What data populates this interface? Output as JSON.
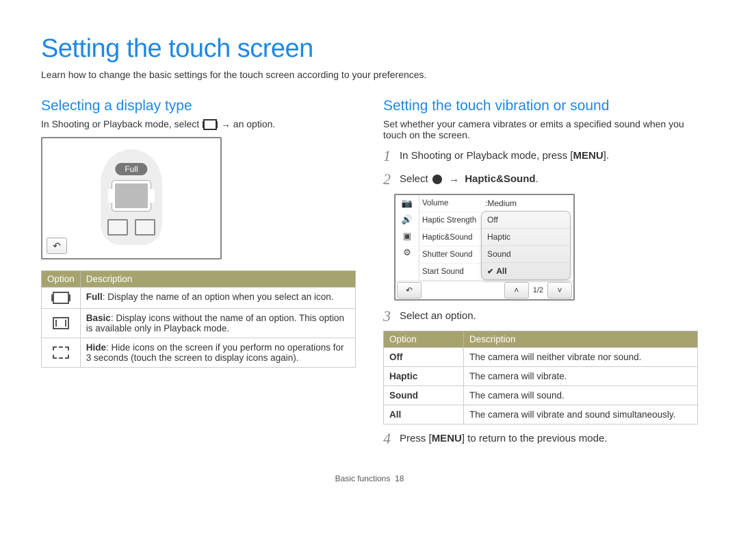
{
  "page": {
    "title": "Setting the touch screen",
    "intro": "Learn how to change the basic settings for the touch screen according to your preferences.",
    "footer_section": "Basic functions",
    "footer_page": "18"
  },
  "left": {
    "heading": "Selecting a display type",
    "lead_a": "In Shooting or Playback mode, select ",
    "lead_b": " → an option.",
    "full_badge": "Full",
    "table": {
      "h_option": "Option",
      "h_desc": "Description",
      "rows": [
        {
          "label": "Full",
          "desc": ": Display the name of an option when you select an icon."
        },
        {
          "label": "Basic",
          "desc": ": Display icons without the name of an option. This option is available only in Playback mode."
        },
        {
          "label": "Hide",
          "desc": ": Hide icons on the screen if you perform no operations for 3 seconds (touch the screen to display icons again)."
        }
      ]
    }
  },
  "right": {
    "heading": "Setting the touch vibration or sound",
    "lead": "Set whether your camera vibrates or emits a specified sound when you touch on the screen.",
    "steps": {
      "s1a": "In Shooting or Playback mode, press [",
      "s1b": "MENU",
      "s1c": "].",
      "s2a": "Select ",
      "s2b": " → ",
      "s2c": "Haptic&Sound",
      "s2d": ".",
      "s3": "Select an option.",
      "s4a": "Press [",
      "s4b": "MENU",
      "s4c": "] to return to the previous mode."
    },
    "lcd": {
      "labels": [
        "Volume",
        "Haptic Strength",
        "Haptic&Sound",
        "Shutter Sound",
        "Start Sound"
      ],
      "volume_val": ":Medium",
      "popup": [
        "Off",
        "Haptic",
        "Sound",
        "All"
      ],
      "page": "1/2"
    },
    "table": {
      "h_option": "Option",
      "h_desc": "Description",
      "rows": [
        {
          "opt": "Off",
          "desc": "The camera will neither vibrate nor sound."
        },
        {
          "opt": "Haptic",
          "desc": "The camera will vibrate."
        },
        {
          "opt": "Sound",
          "desc": "The camera will sound."
        },
        {
          "opt": "All",
          "desc": "The camera will vibrate and sound simultaneously."
        }
      ]
    }
  }
}
